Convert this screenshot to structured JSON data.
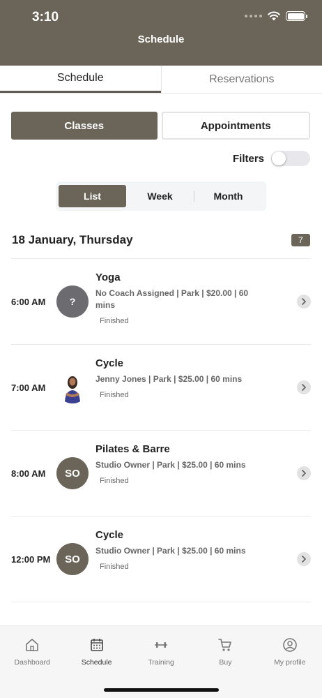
{
  "status_bar": {
    "time": "3:10"
  },
  "header": {
    "title": "Schedule"
  },
  "tabs": [
    {
      "label": "Schedule",
      "active": true
    },
    {
      "label": "Reservations",
      "active": false
    }
  ],
  "segment": {
    "classes_label": "Classes",
    "appointments_label": "Appointments"
  },
  "filters": {
    "label": "Filters",
    "enabled": false
  },
  "view_toggle": [
    {
      "label": "List",
      "active": true
    },
    {
      "label": "Week",
      "active": false
    },
    {
      "label": "Month",
      "active": false
    }
  ],
  "date": {
    "label": "18 January, Thursday",
    "count": "7"
  },
  "sessions": [
    {
      "time": "6:00 AM",
      "avatar": "?",
      "name": "Yoga",
      "details": "No Coach Assigned | Park | $20.00 | 60 mins",
      "status": "Finished"
    },
    {
      "time": "7:00 AM",
      "avatar": "",
      "name": "Cycle",
      "details": "Jenny Jones | Park | $25.00 | 60 mins",
      "status": "Finished"
    },
    {
      "time": "8:00 AM",
      "avatar": "SO",
      "name": "Pilates & Barre",
      "details": "Studio Owner | Park | $25.00 | 60 mins",
      "status": "Finished"
    },
    {
      "time": "12:00 PM",
      "avatar": "SO",
      "name": "Cycle",
      "details": "Studio Owner | Park | $25.00 | 60 mins",
      "status": "Finished"
    }
  ],
  "bottom_nav": [
    {
      "label": "Dashboard",
      "icon": "home-icon",
      "active": false
    },
    {
      "label": "Schedule",
      "icon": "calendar-icon",
      "active": true
    },
    {
      "label": "Training",
      "icon": "dumbbell-icon",
      "active": false
    },
    {
      "label": "Buy",
      "icon": "cart-icon",
      "active": false
    },
    {
      "label": "My profile",
      "icon": "profile-icon",
      "active": false
    }
  ],
  "colors": {
    "brand": "#6b6459",
    "header_bg": "#6b6459"
  }
}
